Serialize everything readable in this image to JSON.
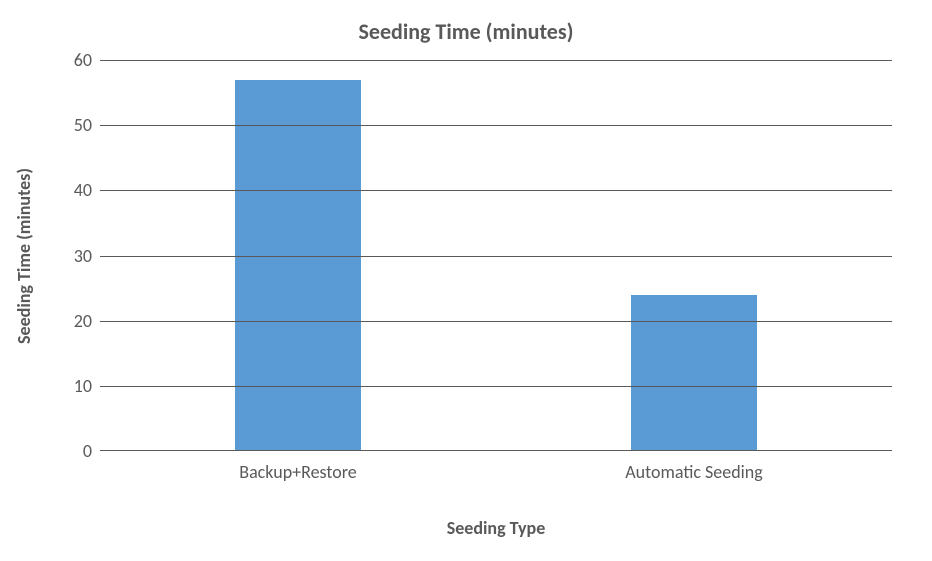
{
  "chart_data": {
    "type": "bar",
    "title": "Seeding Time (minutes)",
    "xlabel": "Seeding Type",
    "ylabel": "Seeding Time (minutes)",
    "categories": [
      "Backup+Restore",
      "Automatic Seeding"
    ],
    "values": [
      57,
      24
    ],
    "ylim": [
      0,
      60
    ],
    "yticks": [
      0,
      10,
      20,
      30,
      40,
      50,
      60
    ],
    "bar_color": "#5b9bd5",
    "grid": true
  }
}
